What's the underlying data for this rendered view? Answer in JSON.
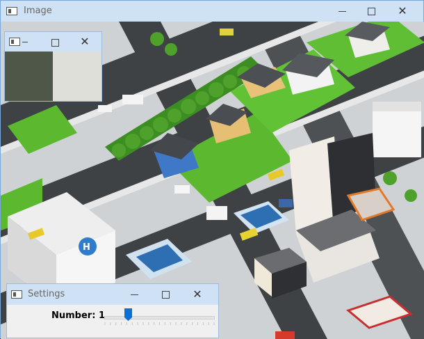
{
  "main_window": {
    "title": "Image",
    "controls": {
      "minimize": "",
      "maximize": "",
      "close": "✕"
    }
  },
  "preview_window": {
    "title": "",
    "swatches": [
      "#4f5848",
      "#dfdfd9"
    ]
  },
  "settings_window": {
    "title": "Settings",
    "slider": {
      "label": "Number: 1",
      "value": 1,
      "min": 0,
      "max": 20
    }
  }
}
